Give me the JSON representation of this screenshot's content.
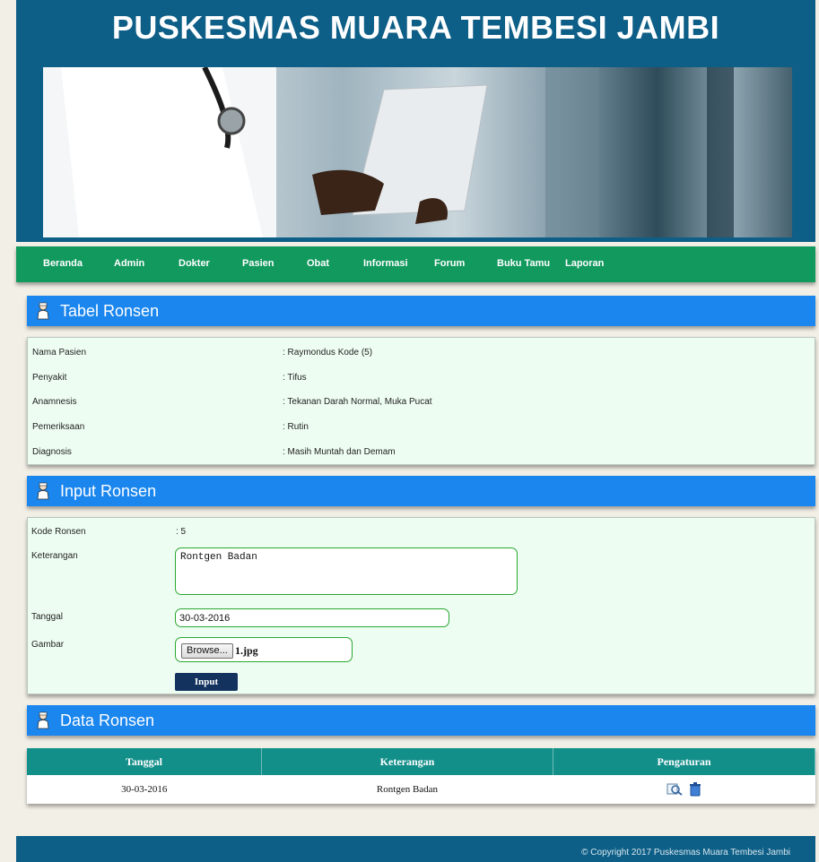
{
  "site": {
    "title": "PUSKESMAS MUARA TEMBESI JAMBI"
  },
  "nav": {
    "items": [
      "Beranda",
      "Admin",
      "Dokter",
      "Pasien",
      "Obat",
      "Informasi",
      "Forum",
      "Buku Tamu",
      "Laporan"
    ]
  },
  "tabel_ronsen": {
    "title": "Tabel Ronsen",
    "rows": [
      {
        "label": "Nama Pasien",
        "value": ": Raymondus Kode (5)"
      },
      {
        "label": "Penyakit",
        "value": ": Tifus"
      },
      {
        "label": "Anamnesis",
        "value": ": Tekanan Darah Normal, Muka Pucat"
      },
      {
        "label": "Pemeriksaan",
        "value": ": Rutin"
      },
      {
        "label": "Diagnosis",
        "value": ": Masih Muntah dan Demam"
      }
    ]
  },
  "input_ronsen": {
    "title": "Input Ronsen",
    "kode_label": "Kode Ronsen",
    "kode_value": ": 5",
    "keterangan_label": "Keterangan",
    "keterangan_value": "Rontgen Badan",
    "tanggal_label": "Tanggal",
    "tanggal_value": "30-03-2016",
    "gambar_label": "Gambar",
    "browse_label": "Browse...",
    "file_name": "1.jpg",
    "submit_label": "Input"
  },
  "data_ronsen": {
    "title": "Data Ronsen",
    "headers": [
      "Tanggal",
      "Keterangan",
      "Pengaturan"
    ],
    "rows": [
      {
        "tanggal": "30-03-2016",
        "keterangan": "Rontgen Badan"
      }
    ]
  },
  "footer": {
    "text": "© Copyright 2017 Puskesmas Muara Tembesi Jambi"
  },
  "colors": {
    "header": "#0e5f87",
    "nav": "#12995e",
    "section": "#1a86ee",
    "table_header": "#138f8a"
  }
}
